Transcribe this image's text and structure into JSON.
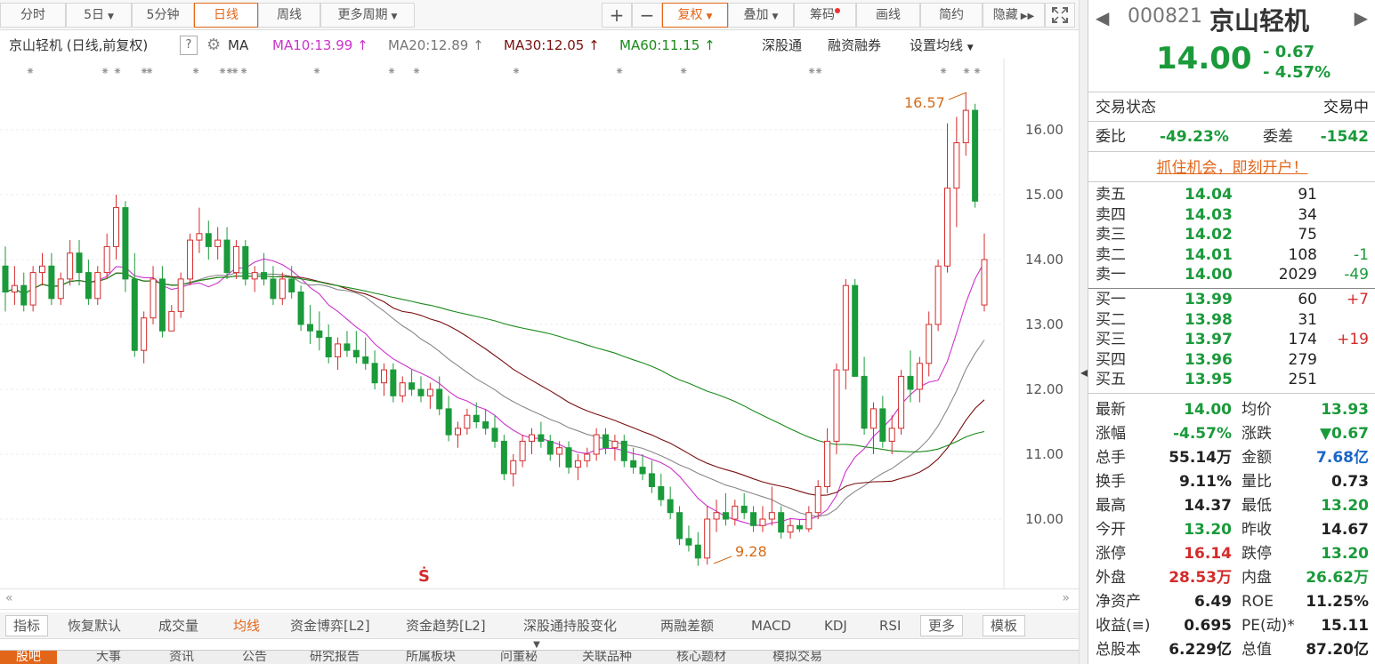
{
  "toolbar": {
    "periods": [
      "分时",
      "5日",
      "5分钟",
      "日线",
      "周线",
      "更多周期"
    ],
    "active_period": "日线",
    "tools": [
      "+",
      "−",
      "复权",
      "叠加",
      "筹码",
      "画线",
      "简约",
      "隐藏"
    ]
  },
  "ma_line": {
    "name": "京山轻机 (日线,前复权)",
    "help": "?",
    "ma_label": "MA",
    "ma10": "MA10:13.99",
    "ma20": "MA20:12.89",
    "ma30": "MA30:12.05",
    "ma60": "MA60:11.15",
    "links": [
      "深股通",
      "融资融券",
      "设置均线"
    ]
  },
  "chart_data": {
    "type": "candlestick",
    "y_ticks": [
      "16.00",
      "15.00",
      "14.00",
      "13.00",
      "12.00",
      "11.00",
      "10.00"
    ],
    "ylim": [
      9.0,
      17.0
    ],
    "annotations": {
      "high": "16.57",
      "low": "9.28"
    },
    "candles": [
      [
        13.9,
        14.2,
        13.2,
        13.5
      ],
      [
        13.5,
        13.9,
        13.3,
        13.6
      ],
      [
        13.6,
        13.8,
        13.2,
        13.3
      ],
      [
        13.3,
        13.9,
        13.2,
        13.8
      ],
      [
        13.8,
        14.1,
        13.6,
        13.9
      ],
      [
        13.9,
        14.1,
        13.3,
        13.4
      ],
      [
        13.4,
        13.8,
        13.3,
        13.7
      ],
      [
        13.7,
        14.3,
        13.6,
        14.1
      ],
      [
        14.1,
        14.3,
        13.6,
        13.8
      ],
      [
        13.8,
        14.0,
        13.3,
        13.4
      ],
      [
        13.4,
        13.9,
        13.3,
        13.8
      ],
      [
        13.8,
        14.4,
        13.7,
        14.2
      ],
      [
        14.2,
        15.0,
        14.0,
        14.8
      ],
      [
        14.8,
        14.9,
        13.5,
        13.7
      ],
      [
        13.7,
        14.1,
        12.5,
        12.6
      ],
      [
        12.6,
        13.2,
        12.4,
        13.1
      ],
      [
        13.1,
        13.9,
        13.0,
        13.7
      ],
      [
        13.7,
        13.9,
        12.8,
        12.9
      ],
      [
        12.9,
        13.3,
        12.9,
        13.2
      ],
      [
        13.2,
        13.8,
        13.1,
        13.7
      ],
      [
        13.7,
        14.4,
        13.6,
        14.3
      ],
      [
        14.3,
        14.8,
        14.1,
        14.4
      ],
      [
        14.4,
        14.6,
        14.0,
        14.2
      ],
      [
        14.2,
        14.5,
        14.0,
        14.3
      ],
      [
        14.3,
        14.5,
        13.7,
        13.8
      ],
      [
        13.8,
        14.3,
        13.7,
        14.2
      ],
      [
        14.2,
        14.3,
        13.6,
        13.7
      ],
      [
        13.7,
        13.9,
        13.5,
        13.8
      ],
      [
        13.8,
        14.1,
        13.6,
        13.7
      ],
      [
        13.7,
        13.9,
        13.3,
        13.4
      ],
      [
        13.4,
        13.8,
        13.3,
        13.7
      ],
      [
        13.7,
        13.9,
        13.4,
        13.5
      ],
      [
        13.5,
        13.6,
        12.9,
        13.0
      ],
      [
        13.0,
        13.3,
        12.7,
        12.9
      ],
      [
        12.9,
        13.2,
        12.6,
        12.8
      ],
      [
        12.8,
        13.0,
        12.4,
        12.5
      ],
      [
        12.5,
        12.8,
        12.3,
        12.7
      ],
      [
        12.7,
        12.9,
        12.5,
        12.6
      ],
      [
        12.6,
        12.9,
        12.4,
        12.5
      ],
      [
        12.5,
        12.8,
        12.3,
        12.4
      ],
      [
        12.4,
        12.6,
        12.0,
        12.1
      ],
      [
        12.1,
        12.4,
        11.9,
        12.3
      ],
      [
        12.3,
        12.4,
        11.8,
        11.9
      ],
      [
        11.9,
        12.2,
        11.8,
        12.1
      ],
      [
        12.1,
        12.3,
        11.9,
        12.0
      ],
      [
        12.0,
        12.2,
        11.8,
        11.9
      ],
      [
        11.9,
        12.1,
        11.7,
        12.0
      ],
      [
        12.0,
        12.2,
        11.6,
        11.7
      ],
      [
        11.7,
        11.9,
        11.2,
        11.3
      ],
      [
        11.3,
        11.5,
        11.1,
        11.4
      ],
      [
        11.4,
        11.7,
        11.3,
        11.6
      ],
      [
        11.6,
        11.8,
        11.4,
        11.5
      ],
      [
        11.5,
        11.7,
        11.3,
        11.4
      ],
      [
        11.4,
        11.6,
        11.1,
        11.2
      ],
      [
        11.2,
        11.3,
        10.6,
        10.7
      ],
      [
        10.7,
        11.0,
        10.5,
        10.9
      ],
      [
        10.9,
        11.3,
        10.8,
        11.2
      ],
      [
        11.2,
        11.4,
        11.0,
        11.3
      ],
      [
        11.3,
        11.5,
        11.1,
        11.2
      ],
      [
        11.2,
        11.3,
        10.9,
        11.0
      ],
      [
        11.0,
        11.2,
        10.8,
        11.1
      ],
      [
        11.1,
        11.2,
        10.7,
        10.8
      ],
      [
        10.8,
        11.0,
        10.6,
        10.9
      ],
      [
        10.9,
        11.1,
        10.8,
        11.0
      ],
      [
        11.0,
        11.4,
        10.9,
        11.3
      ],
      [
        11.3,
        11.4,
        11.0,
        11.1
      ],
      [
        11.1,
        11.3,
        10.9,
        11.2
      ],
      [
        11.2,
        11.3,
        10.8,
        10.9
      ],
      [
        10.9,
        11.1,
        10.7,
        10.8
      ],
      [
        10.8,
        11.0,
        10.6,
        10.7
      ],
      [
        10.7,
        10.9,
        10.4,
        10.5
      ],
      [
        10.5,
        10.7,
        10.2,
        10.3
      ],
      [
        10.3,
        10.5,
        10.0,
        10.1
      ],
      [
        10.1,
        10.2,
        9.6,
        9.7
      ],
      [
        9.7,
        9.9,
        9.5,
        9.6
      ],
      [
        9.6,
        9.8,
        9.28,
        9.4
      ],
      [
        9.4,
        10.2,
        9.3,
        10.0
      ],
      [
        10.0,
        10.3,
        9.8,
        10.1
      ],
      [
        10.1,
        10.4,
        9.9,
        10.0
      ],
      [
        10.0,
        10.3,
        9.9,
        10.2
      ],
      [
        10.2,
        10.4,
        10.0,
        10.1
      ],
      [
        10.1,
        10.2,
        9.8,
        9.9
      ],
      [
        9.9,
        10.2,
        9.8,
        10.0
      ],
      [
        10.0,
        10.5,
        9.9,
        10.1
      ],
      [
        10.1,
        10.2,
        9.7,
        9.8
      ],
      [
        9.8,
        10.0,
        9.7,
        9.9
      ],
      [
        9.9,
        10.0,
        9.8,
        9.85
      ],
      [
        9.85,
        10.2,
        9.8,
        10.1
      ],
      [
        10.1,
        10.6,
        10.0,
        10.5
      ],
      [
        10.5,
        11.4,
        10.4,
        11.2
      ],
      [
        11.2,
        12.4,
        11.0,
        12.3
      ],
      [
        12.3,
        13.7,
        12.0,
        13.6
      ],
      [
        13.6,
        13.7,
        12.2,
        12.2
      ],
      [
        12.2,
        12.5,
        11.3,
        11.4
      ],
      [
        11.4,
        11.8,
        11.0,
        11.7
      ],
      [
        11.7,
        11.9,
        11.1,
        11.2
      ],
      [
        11.2,
        11.6,
        11.0,
        11.4
      ],
      [
        11.4,
        12.3,
        11.3,
        12.2
      ],
      [
        12.2,
        12.6,
        11.8,
        12.0
      ],
      [
        12.0,
        12.5,
        11.8,
        12.4
      ],
      [
        12.4,
        13.2,
        12.2,
        13.0
      ],
      [
        13.0,
        14.0,
        12.9,
        13.9
      ],
      [
        13.9,
        16.1,
        13.8,
        15.1
      ],
      [
        15.1,
        16.2,
        14.5,
        15.8
      ],
      [
        15.8,
        16.57,
        15.6,
        16.3
      ],
      [
        16.3,
        16.4,
        14.8,
        14.9
      ],
      [
        13.3,
        14.4,
        13.2,
        14.0
      ]
    ]
  },
  "indicator_tabs": [
    "指标",
    "恢复默认",
    "成交量",
    "均线",
    "资金博弈[L2]",
    "资金趋势[L2]",
    "深股通持股变化",
    "两融差额",
    "MACD",
    "KDJ",
    "RSI",
    "更多",
    "模板"
  ],
  "active_indicator": "均线",
  "bottom_tabs": [
    "股吧",
    "大事",
    "资讯",
    "公告",
    "研究报告",
    "所属板块",
    "问董秘",
    "关联品种",
    "核心题材",
    "模拟交易"
  ],
  "quote": {
    "code": "000821",
    "name": "京山轻机",
    "price": "14.00",
    "change": "- 0.67",
    "change_pct": "- 4.57%",
    "status_label": "交易状态",
    "status_value": "交易中",
    "weibi_label": "委比",
    "weibi": "-49.23%",
    "weicha_label": "委差",
    "weicha": "-1542",
    "promo": "抓住机会，即刻开户！",
    "asks": [
      {
        "label": "卖五",
        "price": "14.04",
        "vol": "91",
        "chg": ""
      },
      {
        "label": "卖四",
        "price": "14.03",
        "vol": "34",
        "chg": ""
      },
      {
        "label": "卖三",
        "price": "14.02",
        "vol": "75",
        "chg": ""
      },
      {
        "label": "卖二",
        "price": "14.01",
        "vol": "108",
        "chg": "-1"
      },
      {
        "label": "卖一",
        "price": "14.00",
        "vol": "2029",
        "chg": "-49"
      }
    ],
    "bids": [
      {
        "label": "买一",
        "price": "13.99",
        "vol": "60",
        "chg": "+7"
      },
      {
        "label": "买二",
        "price": "13.98",
        "vol": "31",
        "chg": ""
      },
      {
        "label": "买三",
        "price": "13.97",
        "vol": "174",
        "chg": "+19"
      },
      {
        "label": "买四",
        "price": "13.96",
        "vol": "279",
        "chg": ""
      },
      {
        "label": "买五",
        "price": "13.95",
        "vol": "251",
        "chg": ""
      }
    ],
    "stats": [
      {
        "l1": "最新",
        "v1": "14.00",
        "l2": "均价",
        "v2": "13.93"
      },
      {
        "l1": "涨幅",
        "v1": "-4.57%",
        "l2": "涨跌",
        "v2": "▼0.67"
      },
      {
        "l1": "总手",
        "v1": "55.14万",
        "l2": "金额",
        "v2": "7.68亿"
      },
      {
        "l1": "换手",
        "v1": "9.11%",
        "l2": "量比",
        "v2": "0.73"
      },
      {
        "l1": "最高",
        "v1": "14.37",
        "l2": "最低",
        "v2": "13.20"
      },
      {
        "l1": "今开",
        "v1": "13.20",
        "l2": "昨收",
        "v2": "14.67"
      },
      {
        "l1": "涨停",
        "v1": "16.14",
        "l2": "跌停",
        "v2": "13.20"
      },
      {
        "l1": "外盘",
        "v1": "28.53万",
        "l2": "内盘",
        "v2": "26.62万"
      },
      {
        "l1": "净资产",
        "v1": "6.49",
        "l2": "ROE",
        "v2": "11.25%"
      },
      {
        "l1": "收益(≡)",
        "v1": "0.695",
        "l2": "PE(动)*",
        "v2": "15.11"
      },
      {
        "l1": "总股本",
        "v1": "6.229亿",
        "l2": "总值",
        "v2": "87.20亿"
      }
    ]
  },
  "colors": {
    "up": "#d42b2b",
    "down": "#1a9a3a",
    "accent": "#e2661a",
    "ma10": "#cc33cc",
    "ma20": "#888888",
    "ma30": "#7a1010",
    "ma60": "#1a8a1a"
  }
}
